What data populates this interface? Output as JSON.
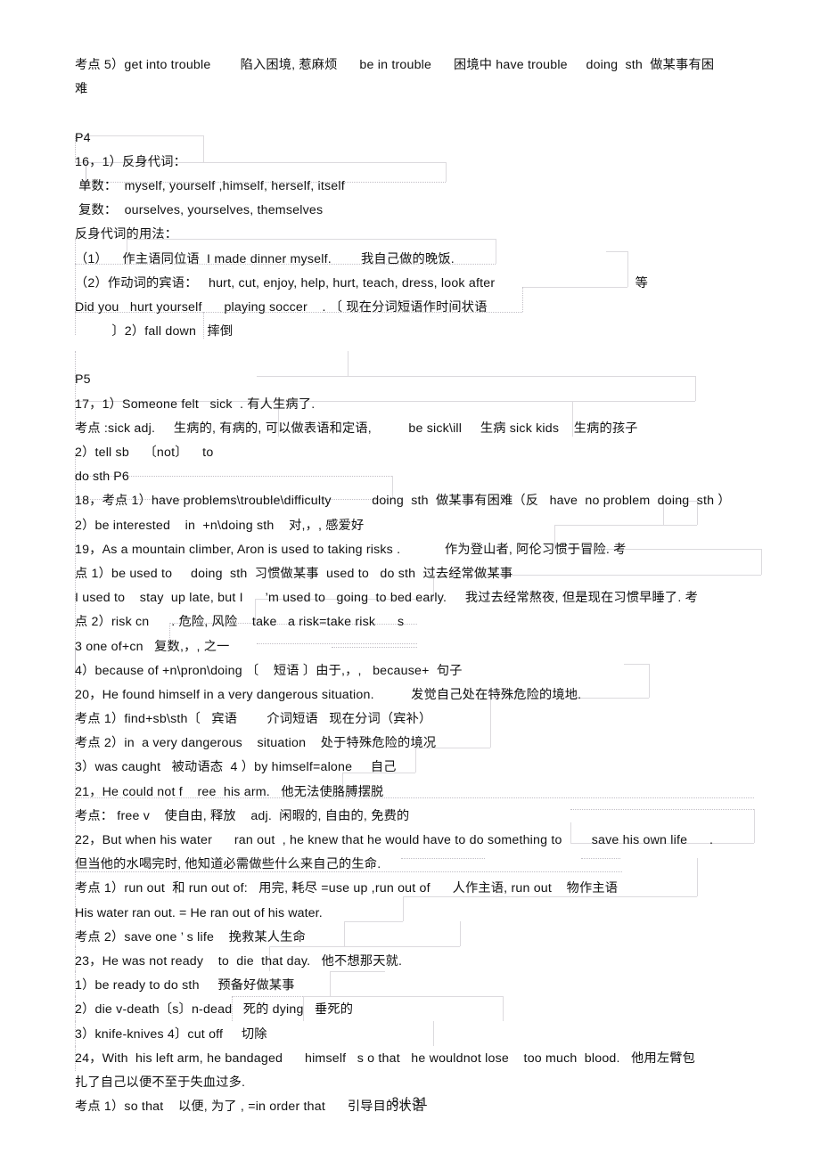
{
  "document": {
    "page_label": "3 /  31",
    "lines": [
      {
        "id": "l1",
        "text": "考点 5）get into trouble        陷入困境, 惹麻烦      be in trouble      困境中 have trouble     doing  sth  做某事有困"
      },
      {
        "id": "l2",
        "text": "难"
      },
      {
        "id": "l3",
        "text": ""
      },
      {
        "id": "l4",
        "text": "P4"
      },
      {
        "id": "l5",
        "text": "16，1）反身代词："
      },
      {
        "id": "l6",
        "text": " 单数：  myself, yourself ,himself, herself, itself"
      },
      {
        "id": "l7",
        "text": " 复数：  ourselves, yourselves, themselves"
      },
      {
        "id": "l8",
        "text": "反身代词的用法："
      },
      {
        "id": "l9",
        "text": "（1）    作主语同位语  I made dinner myself.        我自己做的晚饭."
      },
      {
        "id": "l10",
        "text": "（2）作动词的宾语：   hurt, cut, enjoy, help, hurt, teach, dress, look after                                      等"
      },
      {
        "id": "l11",
        "text": "Did you   hurt yourself      playing soccer    . 〔 现在分词短语作时间状语"
      },
      {
        "id": "l12",
        "text": "          〕2）fall down   摔倒"
      },
      {
        "id": "l13",
        "text": ""
      },
      {
        "id": "l14",
        "text": "P5"
      },
      {
        "id": "l15",
        "text": "17，1）Someone felt   sick  . 有人生病了."
      },
      {
        "id": "l16",
        "text": "考点 :sick adj.     生病的, 有病的, 可以做表语和定语,          be sick\\ill     生病 sick kids    生病的孩子"
      },
      {
        "id": "l17",
        "text": "2）tell sb    〔not〕    to"
      },
      {
        "id": "l18",
        "text": "do sth P6"
      },
      {
        "id": "l19",
        "text": "18，考点 1）have problems\\trouble\\difficulty           doing  sth  做某事有困难（反   have  no problem  doing  sth ）"
      },
      {
        "id": "l20",
        "text": "2）be interested    in  +n\\doing sth    对,，, 感爱好"
      },
      {
        "id": "l21",
        "text": "19，As a mountain climber, Aron is used to taking risks .            作为登山者, 阿伦习惯于冒险. 考"
      },
      {
        "id": "l22",
        "text": "点 1）be used to     doing  sth  习惯做某事  used to   do sth  过去经常做某事"
      },
      {
        "id": "l23",
        "text": "I used to    stay  up late, but I      ’m used to   going  to bed early.     我过去经常熬夜, 但是现在习惯早睡了. 考"
      },
      {
        "id": "l24",
        "text": "点 2）risk cn      . 危险, 风险    take   a risk=take risk      s"
      },
      {
        "id": "l25",
        "text": "3 one of+cn   复数,，, 之一"
      },
      {
        "id": "l26",
        "text": "4）because of +n\\pron\\doing 〔    短语 〕由于,，,   because+  句子"
      },
      {
        "id": "l27",
        "text": "20，He found himself in a very dangerous situation.          发觉自己处在特殊危险的境地."
      },
      {
        "id": "l28",
        "text": "考点 1）find+sb\\sth〔   宾语        介词短语   现在分词（宾补）"
      },
      {
        "id": "l29",
        "text": "考点 2）in  a very dangerous    situation    处于特殊危险的境况"
      },
      {
        "id": "l30",
        "text": "3）was caught   被动语态  4 ）by himself=alone     自己"
      },
      {
        "id": "l31",
        "text": "21，He could not f    ree  his arm.   他无法使胳膊摆脱"
      },
      {
        "id": "l32",
        "text": "考点： free v    使自由, 释放    adj.  闲暇的, 自由的, 免费的"
      },
      {
        "id": "l33",
        "text": "22，But when his water      ran out  , he knew that he would have to do something to        save his own life      ."
      },
      {
        "id": "l34",
        "text": "但当他的水喝完时, 他知道必需做些什么来自己的生命."
      },
      {
        "id": "l35",
        "text": "考点 1）run out  和 run out of:   用完, 耗尽 =use up ,run out of      人作主语, run out    物作主语"
      },
      {
        "id": "l36",
        "text": "His water ran out. = He ran out of his water."
      },
      {
        "id": "l37",
        "text": "考点 2）save one ’ s life    挽救某人生命"
      },
      {
        "id": "l38",
        "text": "23，He was not ready    to  die  that day.   他不想那天就."
      },
      {
        "id": "l39",
        "text": "1）be ready to do sth     预备好做某事"
      },
      {
        "id": "l40",
        "text": "2）die v-death〔s〕n-dead   死的 dying   垂死的"
      },
      {
        "id": "l41",
        "text": "3）knife-knives 4〕cut off     切除"
      },
      {
        "id": "l42",
        "text": "24，With  his left arm, he bandaged      himself   s o that   he wouldnot lose    too much  blood.   他用左臂包"
      },
      {
        "id": "l43",
        "text": "扎了自己以便不至于失血过多."
      },
      {
        "id": "l44",
        "text": "考点 1）so that    以便, 为了 , =in order that      引导目的状语"
      }
    ]
  }
}
